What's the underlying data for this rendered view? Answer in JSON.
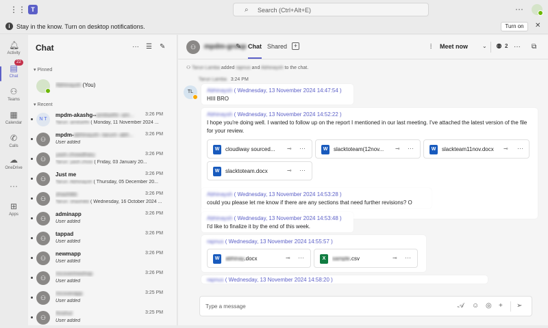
{
  "titlebar": {
    "search_placeholder": "Search (Ctrl+Alt+E)",
    "more": "···"
  },
  "notification": {
    "text": "Stay in the know. Turn on desktop notifications.",
    "button": "Turn on",
    "close": "✕"
  },
  "rail": {
    "items": [
      {
        "label": "Activity",
        "icon": "bell-icon"
      },
      {
        "label": "Chat",
        "icon": "chat-icon",
        "badge": "22"
      },
      {
        "label": "Teams",
        "icon": "teams-icon"
      },
      {
        "label": "Calendar",
        "icon": "calendar-icon"
      },
      {
        "label": "Calls",
        "icon": "phone-icon"
      },
      {
        "label": "OneDrive",
        "icon": "cloud-icon"
      },
      {
        "label": "···",
        "icon": "more-icon"
      },
      {
        "label": "Apps",
        "icon": "apps-icon"
      }
    ]
  },
  "chatlist": {
    "title": "Chat",
    "pinned_label": "Pinned",
    "recent_label": "Recent",
    "pinned": {
      "name": "Abhinaysh",
      "suffix": "(You)"
    },
    "recent": [
      {
        "name": "mpdm-akashg--",
        "blur": "amitsethi--am...",
        "time": "3:26 PM",
        "preview": "( Monday, 11 November 2024 ...",
        "preview_blur": "Tarun: amitsethi",
        "avatar": "N T",
        "italic": false,
        "unread": true
      },
      {
        "name": "mpdm-",
        "blur": "abhinaysh--tarunl--abh...",
        "time": "3:26 PM",
        "preview": "User added",
        "preview_blur": "",
        "avatar": "group",
        "italic": true,
        "unread": true
      },
      {
        "name": "",
        "blur": "yash.chowdhary",
        "time": "3:26 PM",
        "preview": "( Friday, 03 January 20...",
        "preview_blur": "Tarun: yash.chow",
        "avatar": "group",
        "italic": false,
        "unread": true
      },
      {
        "name": "Just me",
        "blur": "",
        "time": "3:26 PM",
        "preview": "( Thursday, 05 December 20...",
        "preview_blur": "Tarun: Abhinaysh",
        "avatar": "group",
        "italic": false,
        "unread": true
      },
      {
        "name": "",
        "blur": "shashikb",
        "time": "3:26 PM",
        "preview": "( Wednesday, 16 October 2024 ...",
        "preview_blur": "Tarun: shashikb",
        "avatar": "group",
        "italic": false,
        "unread": true
      },
      {
        "name": "adminapp",
        "blur": "",
        "time": "3:26 PM",
        "preview": "User added",
        "preview_blur": "",
        "avatar": "group",
        "italic": true,
        "unread": true
      },
      {
        "name": "tappad",
        "blur": "",
        "time": "3:26 PM",
        "preview": "User added",
        "preview_blur": "",
        "avatar": "group",
        "italic": true,
        "unread": true
      },
      {
        "name": "newmapp",
        "blur": "",
        "time": "3:26 PM",
        "preview": "User added",
        "preview_blur": "",
        "avatar": "group",
        "italic": true,
        "unread": true
      },
      {
        "name": "",
        "blur": "mcoverineshop",
        "time": "3:26 PM",
        "preview": "User added",
        "preview_blur": "",
        "avatar": "group",
        "italic": true,
        "unread": true
      },
      {
        "name": "",
        "blur": "mcoverapp",
        "time": "3:25 PM",
        "preview": "User added",
        "preview_blur": "",
        "avatar": "group",
        "italic": true,
        "unread": true
      },
      {
        "name": "",
        "blur": "Anshul",
        "time": "3:25 PM",
        "preview": "User added",
        "preview_blur": "",
        "avatar": "group",
        "italic": true,
        "unread": true
      }
    ]
  },
  "header": {
    "group_name": "mpdm-group",
    "tab_chat": "Chat",
    "tab_shared": "Shared",
    "meet_now": "Meet now",
    "people_count": "2"
  },
  "messages": {
    "system": {
      "actor": "Tarun Lamba",
      "verb": " added ",
      "user1": "rapnus",
      "and": " and ",
      "user2": "Abhinaysh",
      "tail": " to the chat."
    },
    "meta": {
      "sender": "Tarun Lamba",
      "time": "3:24 PM"
    },
    "avatar": "TL",
    "m1": {
      "author": "Abhinaysh",
      "stamp": " ( Wednesday, 13 November 2024 14:47:54 )",
      "body": "HIII BRO"
    },
    "m2": {
      "author": "Abhinaysh",
      "stamp": " ( Wednesday, 13 November 2024 14:52:22 )",
      "body": "I hope you're doing well. I wanted to follow up on the report I mentioned in our last meeting. I've attached the latest version of the file for your review."
    },
    "files": [
      {
        "name": "cloudiway sourced...",
        "type": "W"
      },
      {
        "name": "slacktoteam(12nov...",
        "type": "W"
      },
      {
        "name": "slackteam11nov.docx",
        "type": "W"
      },
      {
        "name": "slacktoteam.docx",
        "type": "W"
      }
    ],
    "m3": {
      "author": "Abhinaysh",
      "stamp": " ( Wednesday, 13 November 2024 14:53:28 )",
      "body": "could you please let me know if there are any sections that need further revisions? O"
    },
    "m4": {
      "author": "Abhinaysh",
      "stamp": " ( Wednesday, 13 November 2024 14:53:48 )",
      "body": "I'd like to finalize it by the end of this week."
    },
    "m5": {
      "author": "rapnus",
      "stamp": " ( Wednesday, 13 November 2024 14:55:57 )"
    },
    "files2": [
      {
        "name_blur": "abhinay",
        "name": ".docx",
        "type": "W"
      },
      {
        "name_blur": "sample",
        "name": ".csv",
        "type": "X"
      }
    ],
    "m6": {
      "author": "rapnus",
      "stamp": " ( Wednesday, 13 November 2024 14:58:20 )"
    }
  },
  "composer": {
    "placeholder": "Type a message"
  }
}
